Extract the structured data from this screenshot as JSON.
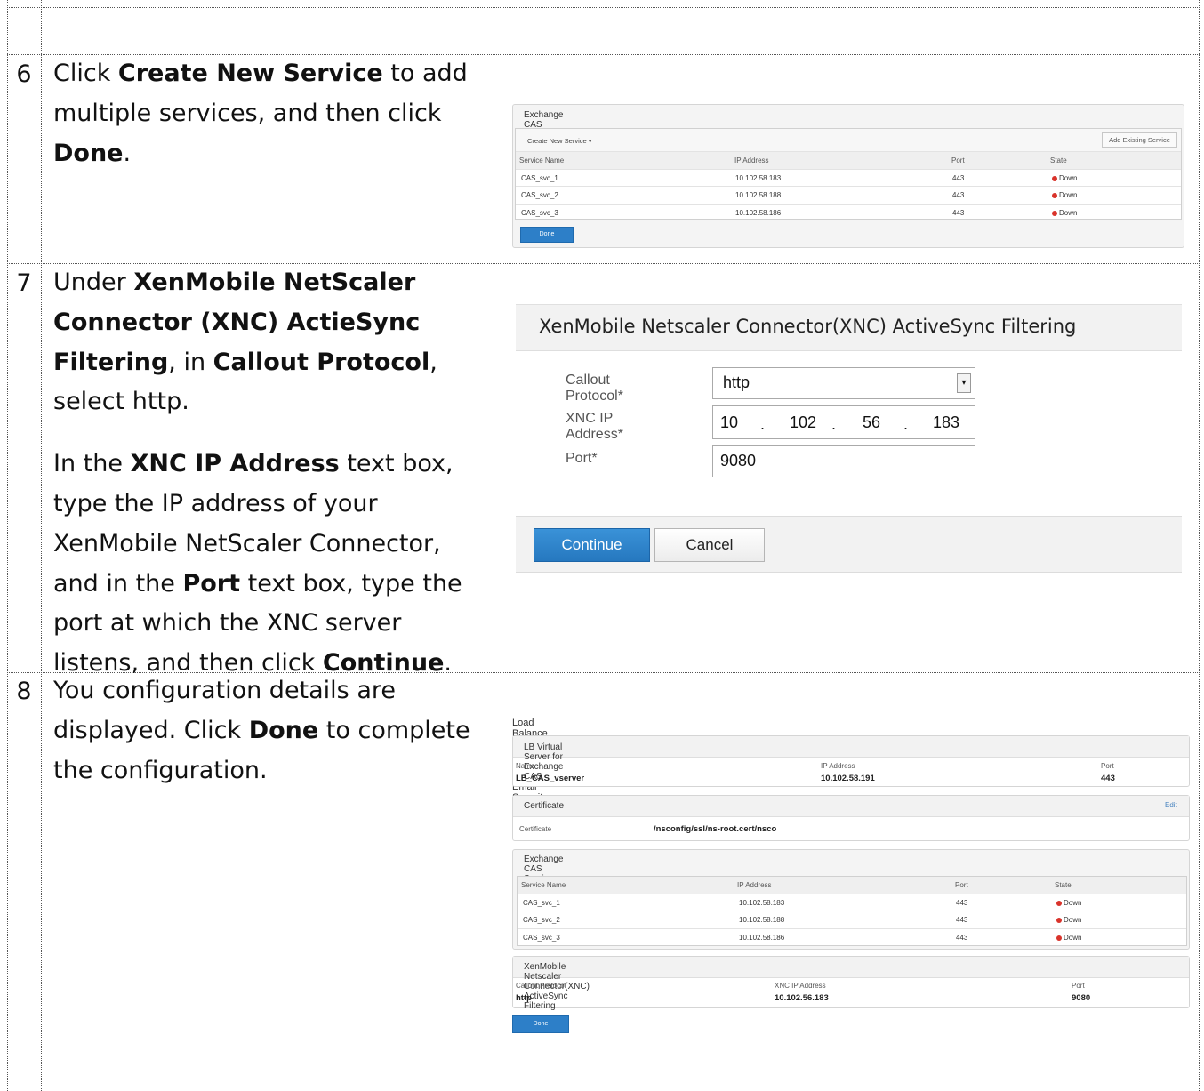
{
  "steps": [
    {
      "number": "6",
      "text": {
        "p1_a": "Click ",
        "p1_b": "Create New Service",
        "p1_c": " to add multiple services, and then click ",
        "p1_d": "Done",
        "p1_e": "."
      }
    },
    {
      "number": "7",
      "text": {
        "p1_a": "Under ",
        "p1_b": "XenMobile NetScaler Connector (XNC) ActieSync Filtering",
        "p1_c": ", in ",
        "p1_d": "Callout Protocol",
        "p1_e": ", select http.",
        "p2_a": "In the ",
        "p2_b": "XNC IP Address",
        "p2_c": " text box, type the IP address of your XenMobile NetScaler Connector, and in the ",
        "p2_d": "Port",
        "p2_e": " text box, type the port at which the XNC server listens, and then click ",
        "p2_f": "Continue",
        "p2_g": "."
      }
    },
    {
      "number": "8",
      "text": {
        "p1_a": "You configuration details are displayed. Click ",
        "p1_b": "Done",
        "p1_c": " to complete the configuration."
      }
    }
  ],
  "shot6": {
    "title": "Exchange CAS Service Instances",
    "create_label": "Create New Service",
    "add_existing_label": "Add Existing Service",
    "columns": [
      "Service Name",
      "IP Address",
      "Port",
      "State"
    ],
    "rows": [
      [
        "CAS_svc_1",
        "10.102.58.183",
        "443",
        "Down"
      ],
      [
        "CAS_svc_2",
        "10.102.58.188",
        "443",
        "Down"
      ],
      [
        "CAS_svc_3",
        "10.102.58.186",
        "443",
        "Down"
      ]
    ],
    "done_label": "Done"
  },
  "shot7": {
    "title": "XenMobile Netscaler Connector(XNC) ActiveSync Filtering",
    "callout_label": "Callout Protocol*",
    "callout_value": "http",
    "ip_label": "XNC IP Address*",
    "ip_octets": [
      "10",
      "102",
      "56",
      "183"
    ],
    "ip_sep": ".",
    "port_label": "Port*",
    "port_value": "9080",
    "continue_label": "Continue",
    "cancel_label": "Cancel"
  },
  "shot8": {
    "page_title": "Load Balance Microsoft Exchange Servers with Email Security Filtering",
    "vserver": {
      "title": "LB Virtual Server for Exchange CAS",
      "name_label": "Name",
      "name_value": "LB_CAS_vserver",
      "ip_label": "IP Address",
      "ip_value": "10.102.58.191",
      "port_label": "Port",
      "port_value": "443"
    },
    "certificate": {
      "title": "Certificate",
      "edit_label": "Edit",
      "label": "Certificate",
      "value": "/nsconfig/ssl/ns-root.cert/nsco"
    },
    "services": {
      "title": "Exchange CAS Service Instances",
      "columns": [
        "Service Name",
        "IP Address",
        "Port",
        "State"
      ],
      "rows": [
        [
          "CAS_svc_1",
          "10.102.58.183",
          "443",
          "Down"
        ],
        [
          "CAS_svc_2",
          "10.102.58.188",
          "443",
          "Down"
        ],
        [
          "CAS_svc_3",
          "10.102.58.186",
          "443",
          "Down"
        ]
      ]
    },
    "xnc": {
      "title": "XenMobile Netscaler Connector(XNC) ActiveSync Filtering",
      "callout_label": "Callout Protocol",
      "callout_value": "http",
      "ip_label": "XNC IP Address",
      "ip_value": "10.102.56.183",
      "port_label": "Port",
      "port_value": "9080"
    },
    "done_label": "Done"
  },
  "colors": {
    "primary_button": "#2d7fc8",
    "status_down": "#d9332b"
  }
}
